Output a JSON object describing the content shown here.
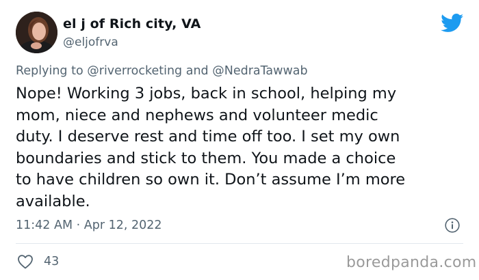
{
  "tweet": {
    "display_name": "el j of Rich city, VA",
    "handle": "@eljofrva",
    "replying_prefix": "Replying to",
    "replying_to_1": "@riverrocketing",
    "replying_and": "and",
    "replying_to_2": "@NedraTawwab",
    "text_lines": [
      "Nope! Working 3 jobs, back in school, helping my",
      "mom, niece and nephews and volunteer medic",
      "duty. I deserve rest and time off too. I set my own",
      "boundaries and stick to them. You made a choice",
      "to have children so own it. Don’t assume I’m more",
      "available."
    ],
    "timestamp": "11:42 AM · Apr 12, 2022",
    "like_count": "43"
  },
  "icons": {
    "brand": "twitter-bird-icon",
    "info": "info-icon",
    "like": "heart-icon"
  },
  "colors": {
    "twitter_blue": "#1d9bf0",
    "secondary_text": "#536471",
    "primary_text": "#0f1419"
  },
  "watermark": "boredpanda.com"
}
